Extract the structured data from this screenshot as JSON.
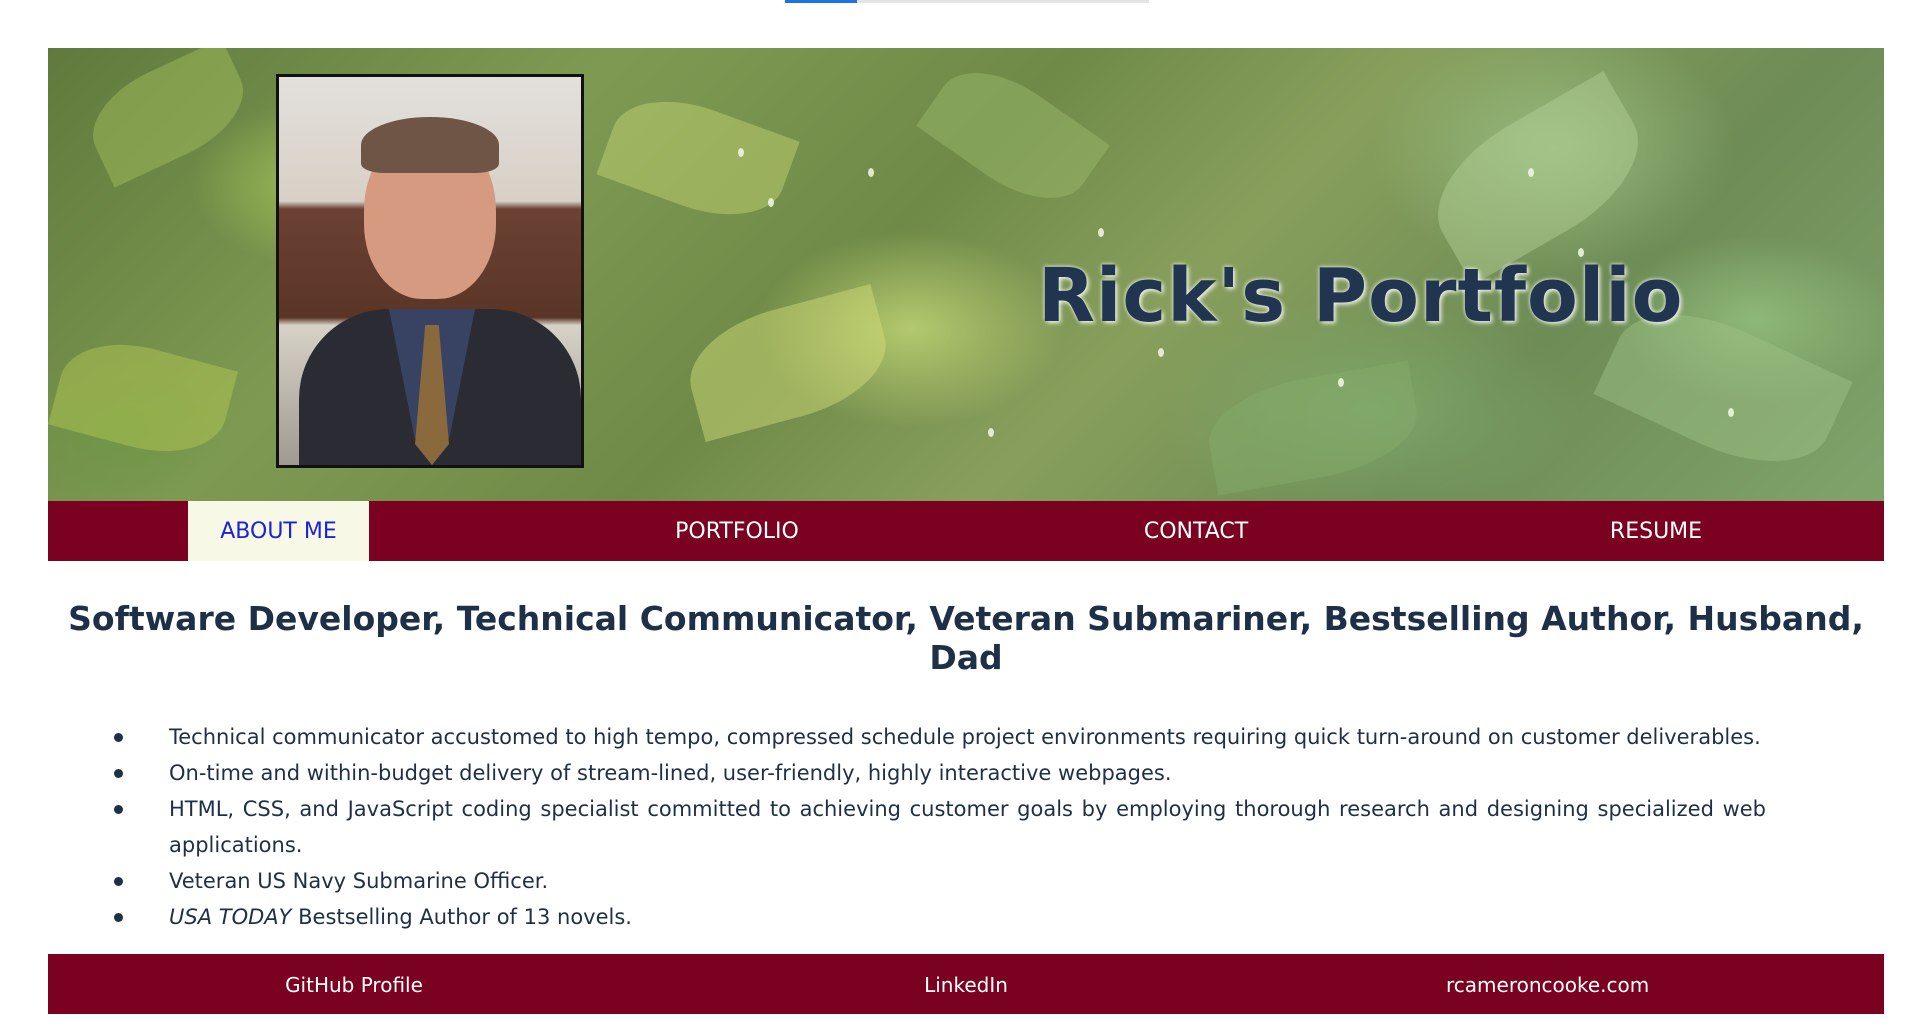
{
  "hero": {
    "title": "Rick's Portfolio",
    "photo_alt": "Portrait of Rick"
  },
  "nav": {
    "items": [
      {
        "label": "ABOUT ME",
        "active": true
      },
      {
        "label": "PORTFOLIO",
        "active": false
      },
      {
        "label": "CONTACT",
        "active": false
      },
      {
        "label": "RESUME",
        "active": false
      }
    ]
  },
  "main": {
    "headline": "Software Developer, Technical Communicator, Veteran Submariner, Bestselling Author, Husband, Dad",
    "bullets": [
      {
        "text": "Technical communicator accustomed to high tempo, compressed schedule project environments requiring quick turn-around on customer deliverables."
      },
      {
        "text": "On-time and within-budget delivery of stream-lined, user-friendly, highly interactive webpages."
      },
      {
        "text": "HTML, CSS, and JavaScript coding specialist committed to achieving customer goals by employing thorough research and designing specialized web applications."
      },
      {
        "text": "Veteran US Navy Submarine Officer."
      },
      {
        "emphasis": "USA TODAY",
        "text": " Bestselling Author of 13 novels."
      }
    ]
  },
  "footer": {
    "links": [
      {
        "label": "GitHub Profile"
      },
      {
        "label": "LinkedIn"
      },
      {
        "label": "rcameroncooke.com"
      }
    ]
  },
  "colors": {
    "nav_bg": "#7a0220",
    "nav_active_bg": "#f7f8e6",
    "nav_active_text": "#1a24d6",
    "heading_text": "#1e3048"
  }
}
